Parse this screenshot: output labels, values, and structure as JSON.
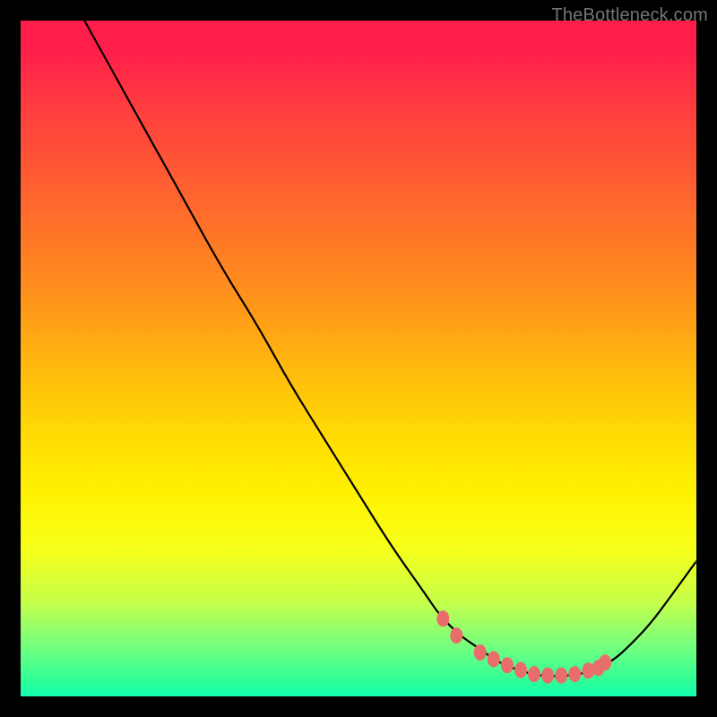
{
  "watermark": "TheBottleneck.com",
  "chart_data": {
    "type": "line",
    "title": "",
    "xlabel": "",
    "ylabel": "",
    "xlim": [
      0,
      100
    ],
    "ylim": [
      0,
      100
    ],
    "series": [
      {
        "name": "bottleneck-curve",
        "x": [
          0,
          5,
          10,
          15,
          20,
          25,
          30,
          35,
          40,
          45,
          50,
          55,
          60,
          62,
          65,
          68,
          70,
          72,
          74,
          76,
          78,
          80,
          82,
          84,
          86,
          88,
          90,
          93,
          96,
          100
        ],
        "y": [
          115,
          108,
          99,
          90,
          81,
          72,
          63,
          55,
          46,
          38,
          30,
          22,
          15,
          12,
          9,
          7,
          5.5,
          4.5,
          3.8,
          3.2,
          3,
          3,
          3.2,
          3.6,
          4.4,
          5.6,
          7.4,
          10.5,
          14.5,
          20
        ]
      }
    ],
    "markers": {
      "name": "optimal-points",
      "x": [
        62.5,
        64.5,
        68,
        70,
        72,
        74,
        76,
        78,
        80,
        82,
        84,
        85.5,
        86.5
      ],
      "y": [
        11.5,
        9,
        6.5,
        5.5,
        4.6,
        3.9,
        3.3,
        3.1,
        3.1,
        3.3,
        3.8,
        4.2,
        5.0
      ]
    },
    "gradient_stops": [
      {
        "pos": 0,
        "color": "#ff1d4b"
      },
      {
        "pos": 28,
        "color": "#ff6a2c"
      },
      {
        "pos": 50,
        "color": "#ffb40f"
      },
      {
        "pos": 70,
        "color": "#fff200"
      },
      {
        "pos": 92,
        "color": "#7bff7a"
      },
      {
        "pos": 100,
        "color": "#13ffb2"
      }
    ]
  }
}
